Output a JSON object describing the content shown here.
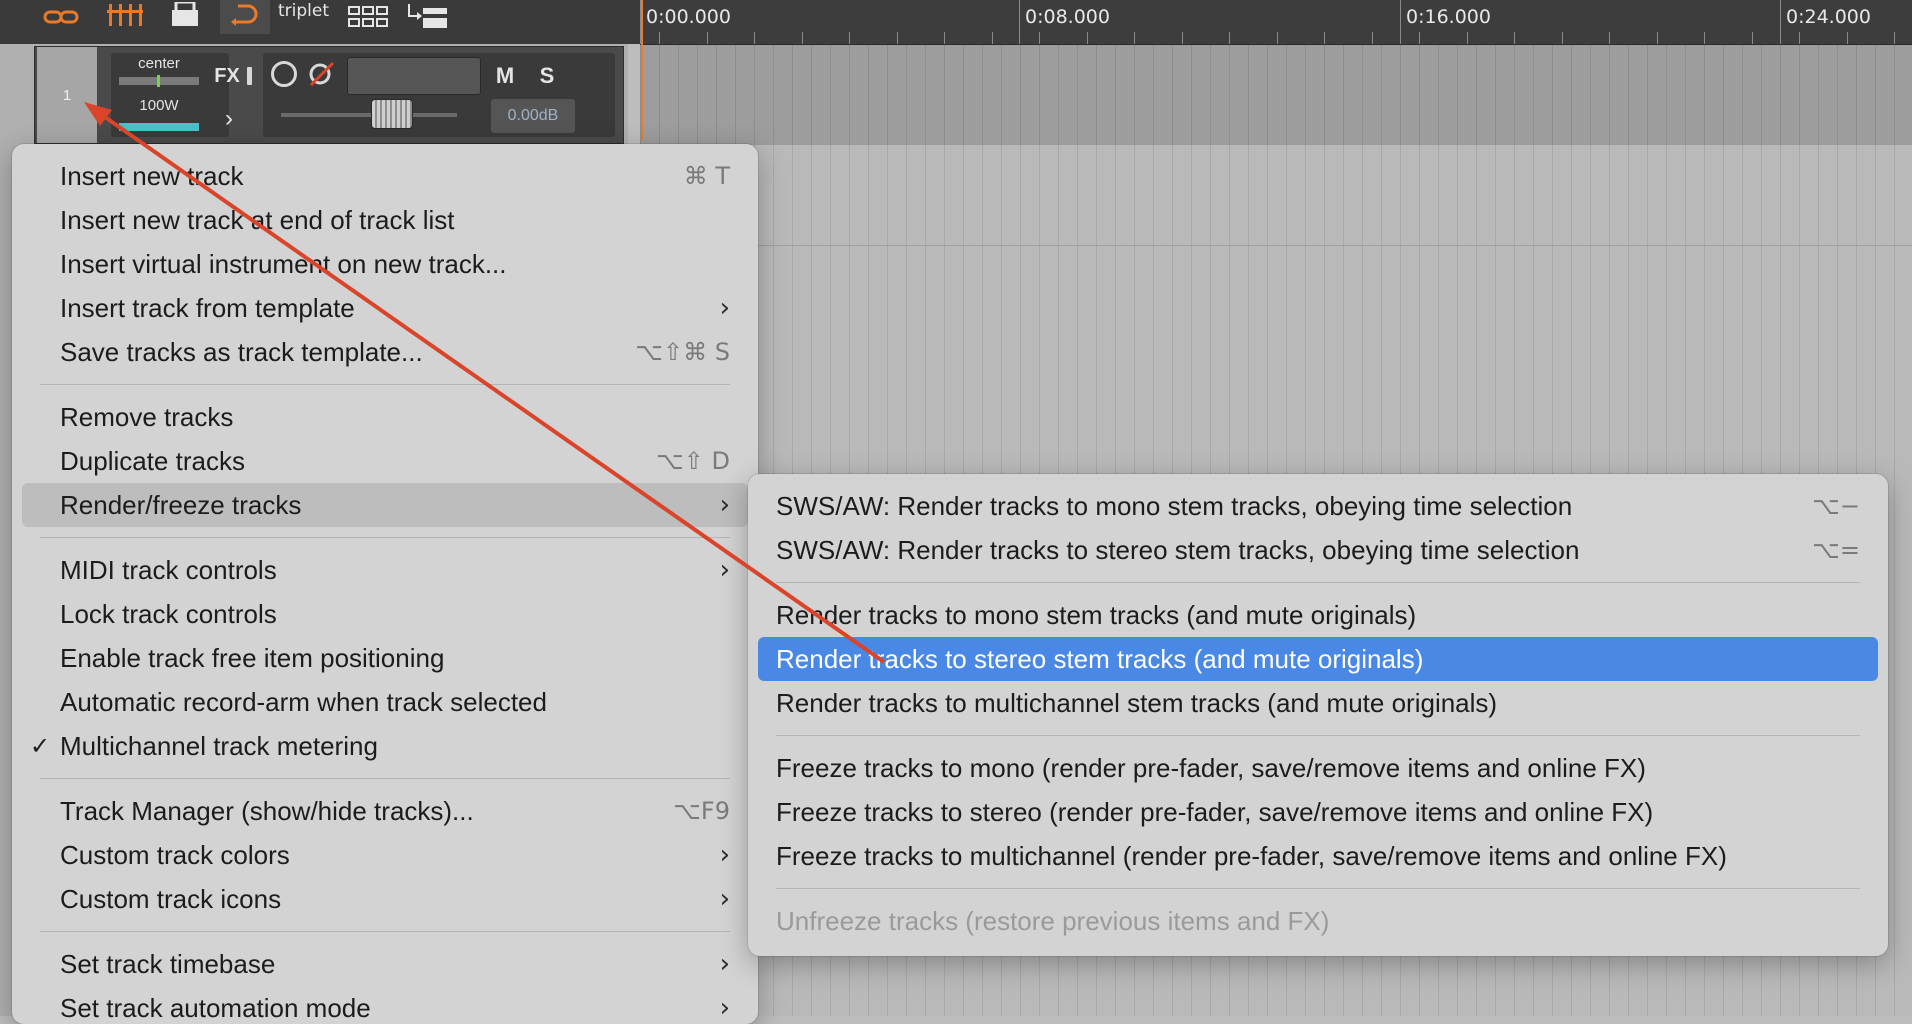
{
  "toolbar": {
    "triplet_label": "triplet",
    "colors": {
      "bg": "#3a3a3a",
      "accent": "#e87a2a"
    },
    "buttons": [
      {
        "icon": "ripple-link-icon"
      },
      {
        "icon": "grid-icon"
      },
      {
        "icon": "lock-icon"
      },
      {
        "icon": "loop-icon"
      },
      {
        "icon": "triplet-grid-icon"
      },
      {
        "icon": "routing-icon"
      }
    ]
  },
  "timeline": {
    "markers": [
      {
        "label": "0:00.000"
      },
      {
        "label": "0:08.000"
      },
      {
        "label": "0:16.000"
      },
      {
        "label": "0:24.000"
      }
    ]
  },
  "track": {
    "number": "1",
    "pan_label": "center",
    "width_label": "100W",
    "fx_label": "FX",
    "mute_label": "M",
    "solo_label": "S",
    "volume": "0.00dB"
  },
  "context_menu": {
    "items": [
      {
        "label": "Insert new track",
        "shortcut": "⌘ T"
      },
      {
        "label": "Insert new track at end of track list"
      },
      {
        "label": "Insert virtual instrument on new track..."
      },
      {
        "label": "Insert track from template",
        "submenu": true
      },
      {
        "label": "Save tracks as track template...",
        "shortcut": "⌥⇧⌘ S"
      },
      {
        "separator": true
      },
      {
        "label": "Remove tracks"
      },
      {
        "label": "Duplicate tracks",
        "shortcut": "⌥⇧ D"
      },
      {
        "label": "Render/freeze tracks",
        "submenu": true,
        "highlighted": true
      },
      {
        "separator": true
      },
      {
        "label": "MIDI track controls",
        "submenu": true
      },
      {
        "label": "Lock track controls"
      },
      {
        "label": "Enable track free item positioning"
      },
      {
        "label": "Automatic record-arm when track selected"
      },
      {
        "label": "Multichannel track metering",
        "checked": true
      },
      {
        "separator": true
      },
      {
        "label": "Track Manager (show/hide tracks)...",
        "shortcut": "⌥F9"
      },
      {
        "label": "Custom track colors",
        "submenu": true
      },
      {
        "label": "Custom track icons",
        "submenu": true
      },
      {
        "separator": true
      },
      {
        "label": "Set track timebase",
        "submenu": true
      },
      {
        "label": "Set track automation mode",
        "submenu": true
      }
    ]
  },
  "render_submenu": {
    "items": [
      {
        "label": "SWS/AW: Render tracks to mono stem tracks, obeying time selection",
        "shortcut": "⌥−"
      },
      {
        "label": "SWS/AW: Render tracks to stereo stem tracks, obeying time selection",
        "shortcut": "⌥="
      },
      {
        "separator": true
      },
      {
        "label": "Render tracks to mono stem tracks (and mute originals)"
      },
      {
        "label": "Render tracks to stereo stem tracks (and mute originals)",
        "selected": true
      },
      {
        "label": "Render tracks to multichannel stem tracks (and mute originals)"
      },
      {
        "separator": true
      },
      {
        "label": "Freeze tracks to mono (render pre-fader, save/remove items and online FX)"
      },
      {
        "label": "Freeze tracks to stereo (render pre-fader, save/remove items and online FX)"
      },
      {
        "label": "Freeze tracks to multichannel (render pre-fader, save/remove items and online FX)"
      },
      {
        "separator": true
      },
      {
        "label": "Unfreeze tracks (restore previous items and FX)",
        "disabled": true
      }
    ]
  },
  "theme": {
    "selection_blue": "#4a88e6",
    "annotation_red": "#d9442a",
    "menu_bg": "#d3d3d3"
  }
}
